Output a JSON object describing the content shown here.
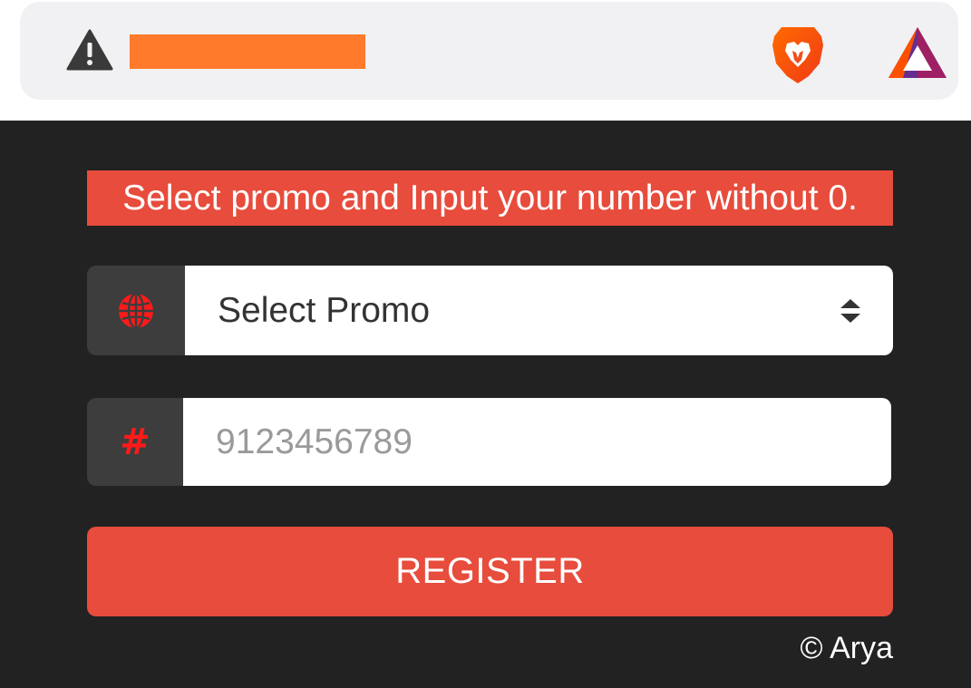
{
  "browser": {
    "security_icon": "warning-triangle-icon",
    "url": "",
    "url_redaction_color": "#ff7a2a",
    "extensions": [
      {
        "name": "brave-shields",
        "icon": "brave-lion-icon"
      },
      {
        "name": "brave-rewards",
        "icon": "bat-triangle-icon"
      }
    ]
  },
  "form": {
    "notice": "Select promo and Input your number without 0.",
    "promo": {
      "icon": "globe-icon",
      "selected": "Select Promo"
    },
    "number": {
      "icon": "hash-icon",
      "icon_glyph": "#",
      "value": "",
      "placeholder": "9123456789"
    },
    "register_label": "REGISTER",
    "credit": "© Arya"
  },
  "colors": {
    "background": "#222222",
    "accent": "#e74c3c",
    "addon": "#3d3d3d",
    "icon_red": "#ff1a1a"
  }
}
